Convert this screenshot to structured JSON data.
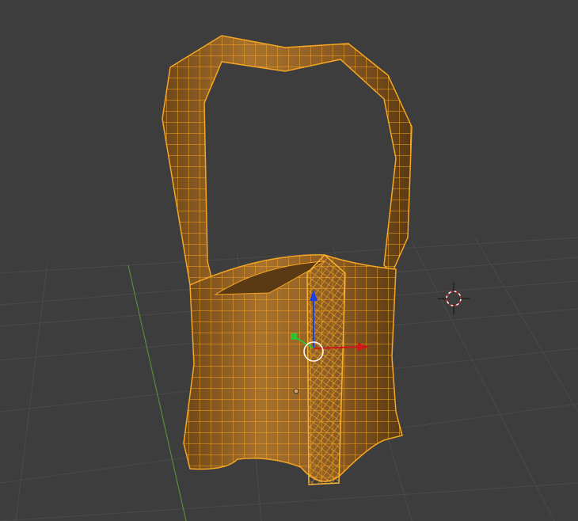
{
  "viewport": {
    "mode": "edit-mode-wireframe",
    "background_color": "#3d3d3d",
    "grid_color": "#4b4b4b",
    "y_axis_color": "#5c8a3a",
    "mesh_color": "#f5a623",
    "mesh_fill": "#8a5a26"
  },
  "gizmo": {
    "x_axis_color": "#d01818",
    "y_axis_color": "#30c030",
    "z_axis_color": "#2040e0"
  },
  "cursor": {
    "icon": "3d-cursor-icon"
  }
}
